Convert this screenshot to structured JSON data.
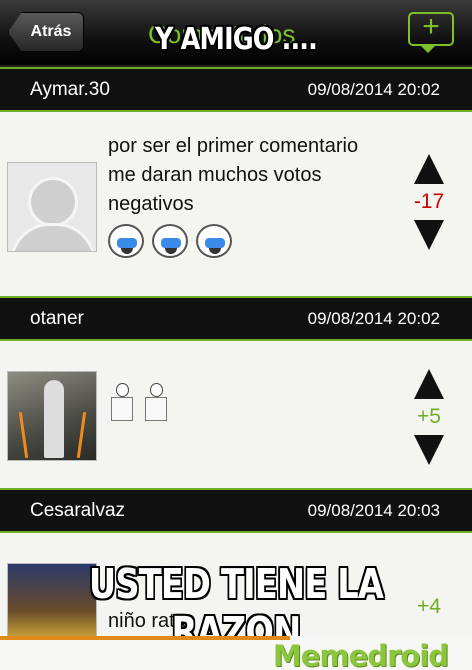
{
  "nav": {
    "back_label": "Atrás",
    "title": "Comentarios",
    "compose_icon": "speech-bubble-plus-icon"
  },
  "captions": {
    "top": "Y AMIGO ....",
    "bottom": "USTED TIENE LA RAZON"
  },
  "comments": [
    {
      "user": "Aymar.30",
      "date": "09/08/2014 20:02",
      "text": "por ser el primer comentario me daran muchos votos negativos",
      "emojis": [
        "crying-meme-face",
        "crying-meme-face",
        "crying-meme-face"
      ],
      "score": "-17",
      "score_color": "#cc0000"
    },
    {
      "user": "otaner",
      "date": "09/08/2014 20:02",
      "text": "",
      "emojis": [
        "stick-figure-meme",
        "stick-figure-meme"
      ],
      "score": "+5",
      "score_color": "#6fae23"
    },
    {
      "user": "Cesaralvaz",
      "date": "09/08/2014 20:03",
      "text": "niño rata",
      "score": "+4",
      "score_color": "#6fae23"
    }
  ],
  "watermark": "Memedroid",
  "colors": {
    "accent": "#6fae23",
    "negative": "#cc0000"
  }
}
